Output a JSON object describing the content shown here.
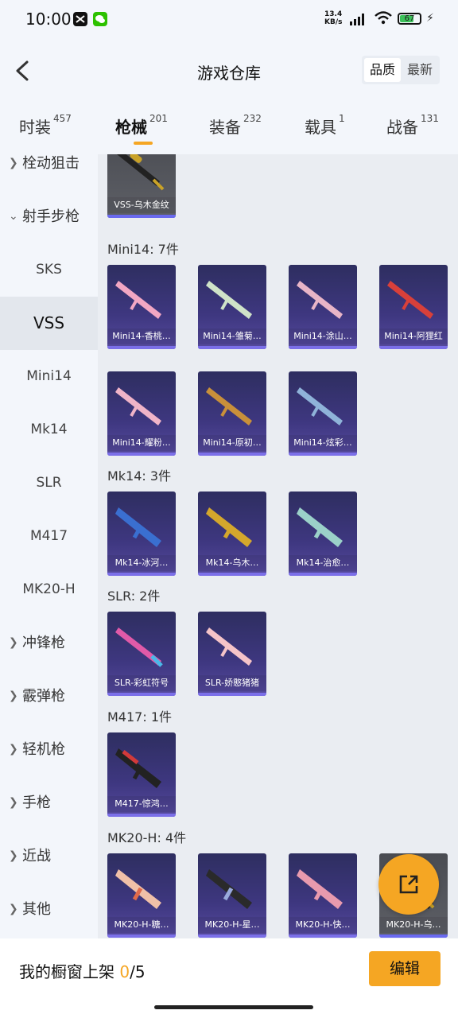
{
  "status_bar": {
    "time": "10:00",
    "net_speed": "13.4",
    "net_unit": "KB/s",
    "battery": "67"
  },
  "header": {
    "title": "游戏仓库",
    "sort_quality": "品质",
    "sort_newest": "最新"
  },
  "tabs": [
    {
      "label": "时装",
      "count": "457"
    },
    {
      "label": "枪械",
      "count": "201"
    },
    {
      "label": "装备",
      "count": "232"
    },
    {
      "label": "载具",
      "count": "1"
    },
    {
      "label": "战备",
      "count": "131"
    }
  ],
  "sidebar": {
    "items": [
      {
        "label": "栓动狙击"
      },
      {
        "label": "射手步枪"
      },
      {
        "label": "SKS"
      },
      {
        "label": "VSS"
      },
      {
        "label": "Mini14"
      },
      {
        "label": "Mk14"
      },
      {
        "label": "SLR"
      },
      {
        "label": "M417"
      },
      {
        "label": "MK20-H"
      },
      {
        "label": "冲锋枪"
      },
      {
        "label": "霰弹枪"
      },
      {
        "label": "轻机枪"
      },
      {
        "label": "手枪"
      },
      {
        "label": "近战"
      },
      {
        "label": "其他"
      }
    ]
  },
  "sections": {
    "vss": {
      "cards": [
        {
          "label": "VSS-乌木金纹"
        }
      ]
    },
    "mini14": {
      "header": "Mini14: 7件",
      "cards": [
        {
          "label": "Mini14-香桃…"
        },
        {
          "label": "Mini14-雏菊…"
        },
        {
          "label": "Mini14-涂山…"
        },
        {
          "label": "Mini14-阿狸红"
        },
        {
          "label": "Mini14-耀粉…"
        },
        {
          "label": "Mini14-原初…"
        },
        {
          "label": "Mini14-炫彩…"
        }
      ]
    },
    "mk14": {
      "header": "Mk14: 3件",
      "cards": [
        {
          "label": "Mk14-冰河…"
        },
        {
          "label": "Mk14-乌木…"
        },
        {
          "label": "Mk14-治愈…"
        }
      ]
    },
    "slr": {
      "header": "SLR: 2件",
      "cards": [
        {
          "label": "SLR-彩虹符号"
        },
        {
          "label": "SLR-娇憨猪猪"
        }
      ]
    },
    "m417": {
      "header": "M417: 1件",
      "cards": [
        {
          "label": "M417-惊鸿…"
        }
      ]
    },
    "mk20": {
      "header": "MK20-H: 4件",
      "cards": [
        {
          "label": "MK20-H-糖…"
        },
        {
          "label": "MK20-H-星…"
        },
        {
          "label": "MK20-H-快…"
        },
        {
          "label": "MK20-H-乌…"
        }
      ]
    }
  },
  "bottom_bar": {
    "text": "我的橱窗上架 ",
    "current": "0",
    "total": "/5",
    "edit_label": "编辑"
  },
  "colors": {
    "accent": "#f5a623",
    "card_bg": "#3e3780",
    "selected_sidebar": "#e3e7ed"
  }
}
